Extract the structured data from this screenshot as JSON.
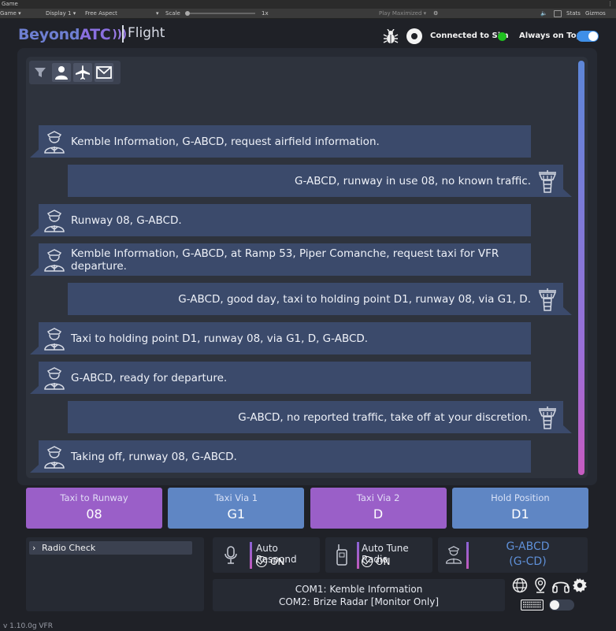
{
  "unity": {
    "window_title": "Game",
    "menu": "⋮",
    "game_dropdown": "Game",
    "display_dropdown": "Display 1",
    "aspect_dropdown": "Free Aspect",
    "scale_label": "Scale",
    "scale_value": "1x",
    "play_maximized": "Play Maximized",
    "stats": "Stats",
    "gizmos": "Gizmos"
  },
  "header": {
    "logo_beyond": "Beyond",
    "logo_atc": "ATC",
    "logo_waves": ")))",
    "section": "Flight",
    "connection_status": "Connected to Sim",
    "connection_color": "#20c020",
    "always_on_top_label": "Always on Top",
    "always_on_top": true
  },
  "filters": {
    "icons": [
      "filter-icon",
      "pilot-filter-icon",
      "aircraft-filter-icon",
      "mail-filter-icon"
    ]
  },
  "messages": [
    {
      "speaker": "pilot",
      "text": "Kemble Information, G-ABCD, request airfield information."
    },
    {
      "speaker": "atc",
      "text": "G-ABCD, runway in use 08, no known traffic."
    },
    {
      "speaker": "pilot",
      "text": "Runway 08, G-ABCD."
    },
    {
      "speaker": "pilot",
      "text": "Kemble Information, G-ABCD, at Ramp 53, Piper Comanche, request taxi for VFR departure."
    },
    {
      "speaker": "atc",
      "text": "G-ABCD, good day, taxi to holding point D1, runway 08, via G1, D."
    },
    {
      "speaker": "pilot",
      "text": "Taxi to holding point D1, runway 08, via G1, D, G-ABCD."
    },
    {
      "speaker": "pilot",
      "text": "G-ABCD, ready for departure."
    },
    {
      "speaker": "atc",
      "text": "G-ABCD, no reported traffic, take off at your discretion."
    },
    {
      "speaker": "pilot",
      "text": "Taking off, runway 08, G-ABCD."
    }
  ],
  "quick": [
    {
      "title": "Taxi to Runway",
      "value": "08",
      "color": "#9a5fc8"
    },
    {
      "title": "Taxi Via 1",
      "value": "G1",
      "color": "#5f86c4"
    },
    {
      "title": "Taxi Via 2",
      "value": "D",
      "color": "#9a5fc8"
    },
    {
      "title": "Hold Position",
      "value": "D1",
      "color": "#5f86c4"
    }
  ],
  "radio_check": "Radio Check",
  "auto_respond": {
    "label": "Auto Respond",
    "value": "ON"
  },
  "auto_tune": {
    "label": "Auto Tune Radio",
    "value": "ON"
  },
  "callsign": {
    "line1": "G-ABCD",
    "line2": "(G-CD)"
  },
  "com": {
    "com1": "COM1: Kemble Information",
    "com2": "COM2: Brize Radar [Monitor Only]"
  },
  "version": "v 1.10.0g VFR"
}
